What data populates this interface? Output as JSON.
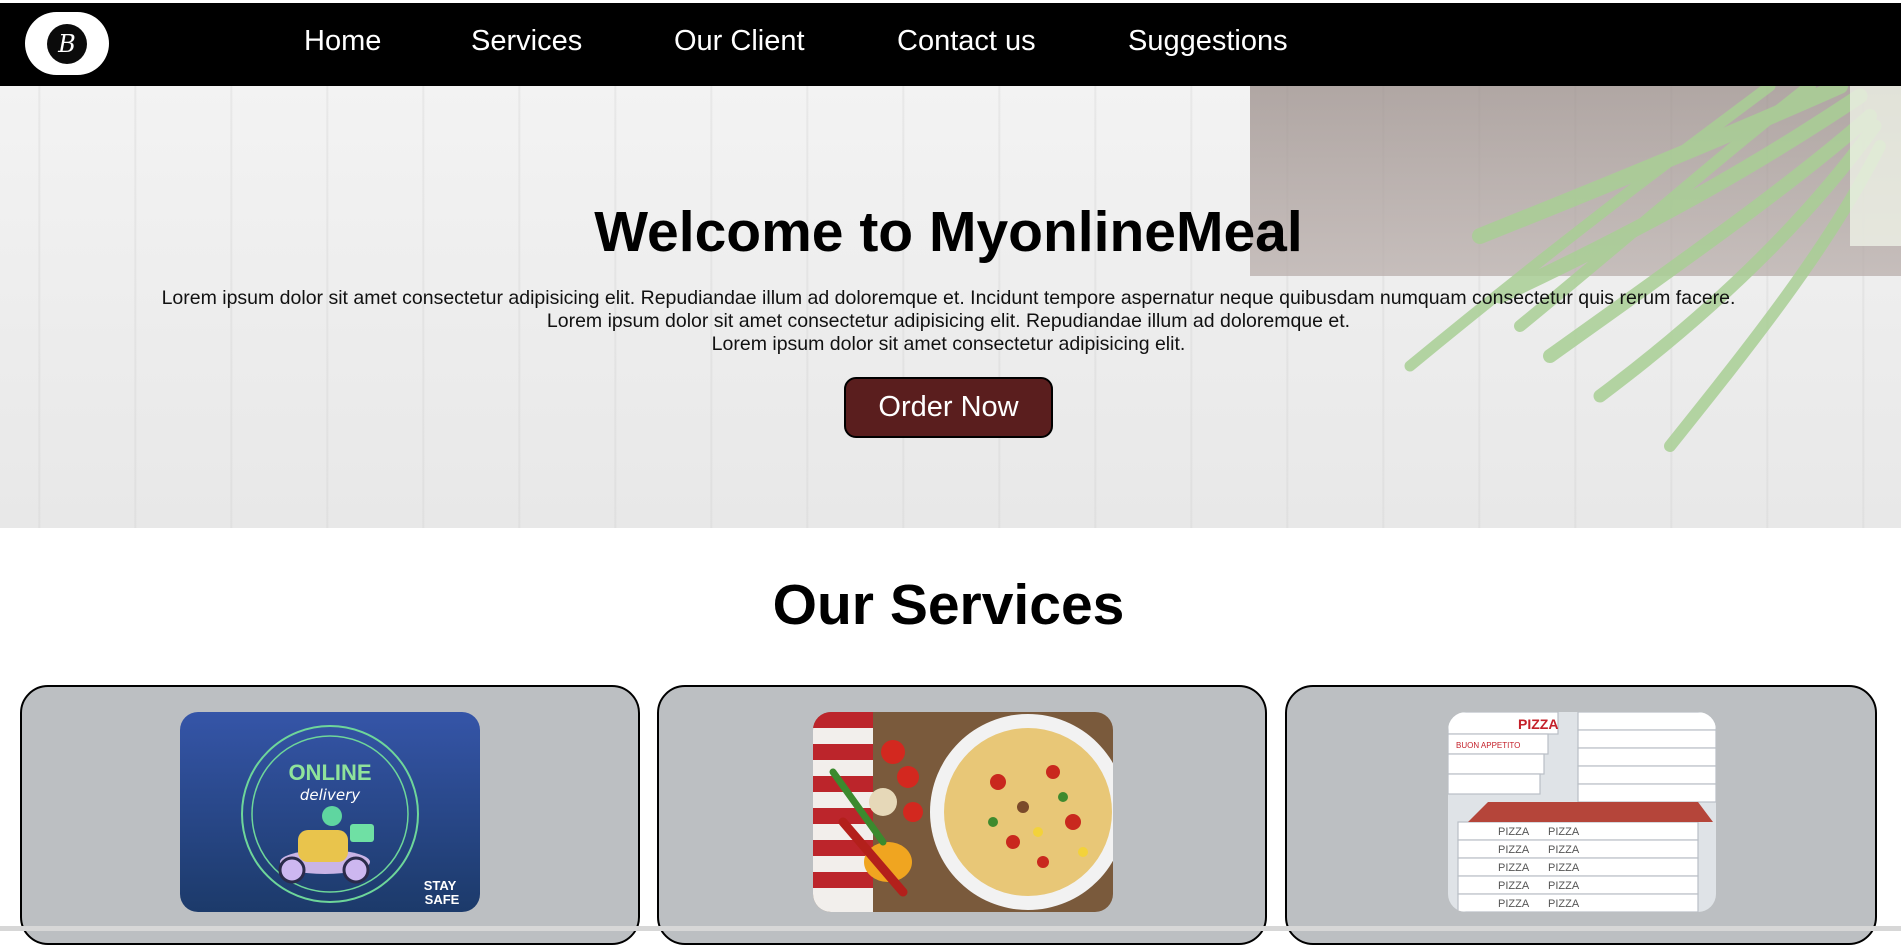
{
  "nav": {
    "logo_letter": "B",
    "links": [
      "Home",
      "Services",
      "Our Client",
      "Contact us",
      "Suggestions"
    ]
  },
  "hero": {
    "title": "Welcome to MyonlineMeal",
    "lines": [
      "Lorem ipsum dolor sit amet consectetur adipisicing elit. Repudiandae illum ad doloremque et. Incidunt tempore aspernatur neque quibusdam numquam consectetur quis rerum facere.",
      "Lorem ipsum dolor sit amet consectetur adipisicing elit. Repudiandae illum ad doloremque et.",
      "Lorem ipsum dolor sit amet consectetur adipisicing elit."
    ],
    "cta_label": "Order Now"
  },
  "services": {
    "title": "Our Services",
    "cards": [
      {
        "image": "online-delivery-image",
        "image_text_1": "ONLINE",
        "image_text_2": "delivery",
        "image_text_3": "STAY",
        "image_text_4": "SAFE"
      },
      {
        "image": "pizza-vegetables-image"
      },
      {
        "image": "pizza-boxes-image",
        "box_label": "PIZZA",
        "box_tag": "BUON APPETITO"
      }
    ]
  },
  "colors": {
    "nav_bg": "#000000",
    "cta_bg": "#5a1e1e",
    "card_bg": "#bcbfc2",
    "delivery_bg": "#2a4a8c",
    "delivery_accent": "#7de08a"
  }
}
